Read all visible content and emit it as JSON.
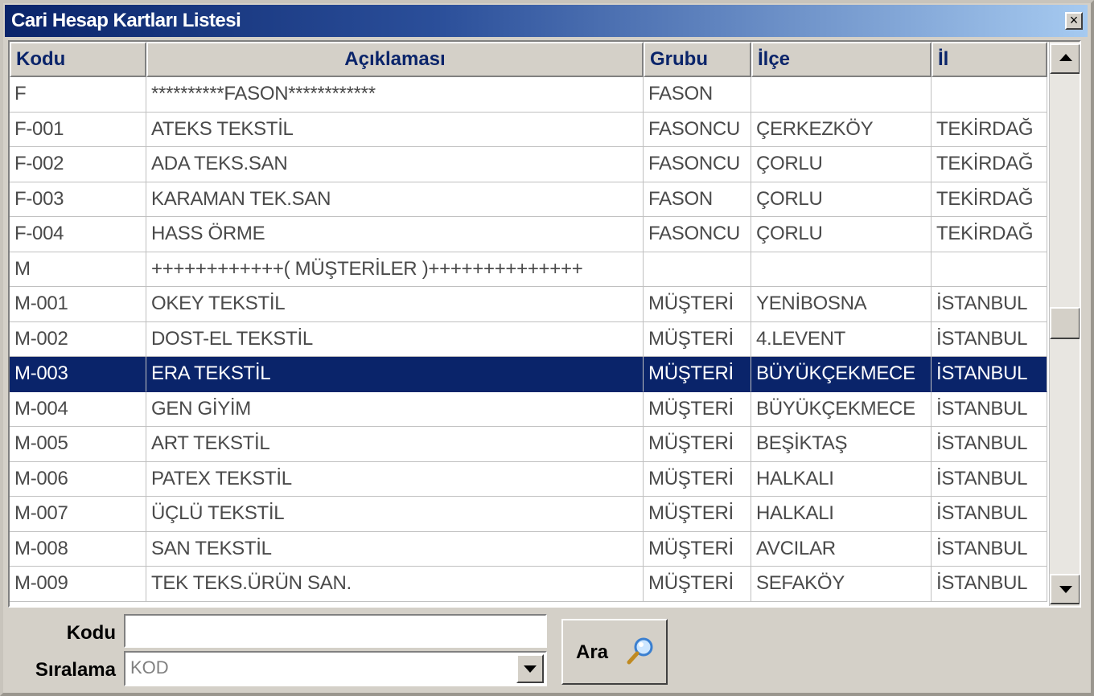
{
  "window": {
    "title": "Cari Hesap Kartları Listesi",
    "close_label": "×"
  },
  "grid": {
    "columns": [
      "Kodu",
      "Açıklaması",
      "Grubu",
      "İlçe",
      "İl"
    ],
    "rows": [
      [
        "F",
        "**********FASON************",
        "FASON",
        "",
        ""
      ],
      [
        "F-001",
        "ATEKS TEKSTİL",
        "FASONCU",
        "ÇERKEZKÖY",
        "TEKİRDAĞ"
      ],
      [
        "F-002",
        "ADA TEKS.SAN",
        "FASONCU",
        "ÇORLU",
        "TEKİRDAĞ"
      ],
      [
        "F-003",
        "KARAMAN TEK.SAN",
        "FASON",
        "ÇORLU",
        "TEKİRDAĞ"
      ],
      [
        "F-004",
        "HASS ÖRME",
        "FASONCU",
        "ÇORLU",
        "TEKİRDAĞ"
      ],
      [
        "M",
        "++++++++++++( MÜŞTERİLER )++++++++++++++",
        "",
        "",
        ""
      ],
      [
        "M-001",
        "OKEY TEKSTİL",
        "MÜŞTERİ",
        "YENİBOSNA",
        "İSTANBUL"
      ],
      [
        "M-002",
        "DOST-EL TEKSTİL",
        "MÜŞTERİ",
        "4.LEVENT",
        "İSTANBUL"
      ],
      [
        "M-003",
        "ERA TEKSTİL",
        "MÜŞTERİ",
        "BÜYÜKÇEKMECE",
        "İSTANBUL"
      ],
      [
        "M-004",
        "GEN GİYİM",
        "MÜŞTERİ",
        "BÜYÜKÇEKMECE",
        "İSTANBUL"
      ],
      [
        "M-005",
        "ART TEKSTİL",
        "MÜŞTERİ",
        "BEŞİKTAŞ",
        "İSTANBUL"
      ],
      [
        "M-006",
        "PATEX TEKSTİL",
        "MÜŞTERİ",
        "HALKALI",
        "İSTANBUL"
      ],
      [
        "M-007",
        "ÜÇLÜ TEKSTİL",
        "MÜŞTERİ",
        "HALKALI",
        "İSTANBUL"
      ],
      [
        "M-008",
        "SAN TEKSTİL",
        "MÜŞTERİ",
        "AVCILAR",
        "İSTANBUL"
      ],
      [
        "M-009",
        "TEK TEKS.ÜRÜN SAN.",
        "MÜŞTERİ",
        "SEFAKÖY",
        "İSTANBUL"
      ]
    ],
    "selected_row_index": 8
  },
  "search": {
    "code_label": "Kodu",
    "code_value": "",
    "sort_label": "Sıralama",
    "sort_value": "KOD",
    "search_button_label": "Ara",
    "search_icon": "magnifier-icon"
  },
  "colors": {
    "title_bar_start": "#0a246a",
    "title_bar_end": "#a6caf0",
    "selection": "#0a246a",
    "header_text": "#0a246a",
    "face": "#d4d0c8"
  }
}
